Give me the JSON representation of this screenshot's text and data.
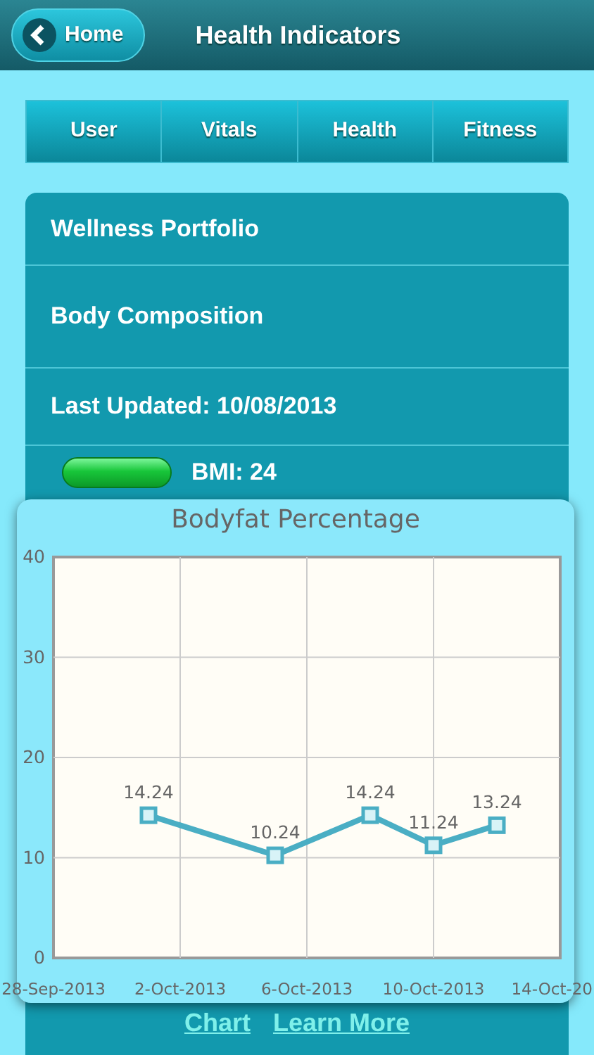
{
  "header": {
    "back_label": "Home",
    "title": "Health Indicators"
  },
  "tabs": [
    {
      "label": "User",
      "selected": false
    },
    {
      "label": "Vitals",
      "selected": false
    },
    {
      "label": "Health",
      "selected": false
    },
    {
      "label": "Fitness",
      "selected": false
    }
  ],
  "list_items": [
    "Wellness Portfolio",
    "Body Composition",
    "Last Updated: 10/08/2013"
  ],
  "bmi": {
    "label": "BMI: 24"
  },
  "popup": {
    "chart_data": {
      "type": "line",
      "title": "Bodyfat Percentage",
      "categories": [
        "28-Sep-2013",
        null,
        null,
        null,
        "2-Oct-2013",
        null,
        null,
        null,
        "6-Oct-2013",
        null,
        null,
        null,
        "10-Oct-2013",
        null,
        null,
        null,
        "14-Oct-20"
      ],
      "grid": true,
      "series": [
        {
          "color": "#4aaec4",
          "marker": "square",
          "values": [
            null,
            null,
            null,
            14.24,
            null,
            null,
            null,
            10.24,
            null,
            null,
            14.24,
            null,
            11.24,
            null,
            13.24,
            null,
            null
          ]
        }
      ],
      "ylim": [
        0,
        40
      ],
      "yticks": [
        0,
        10,
        20,
        30,
        40
      ],
      "data_labels": true
    }
  },
  "links": [
    "Chart",
    "Learn More"
  ]
}
